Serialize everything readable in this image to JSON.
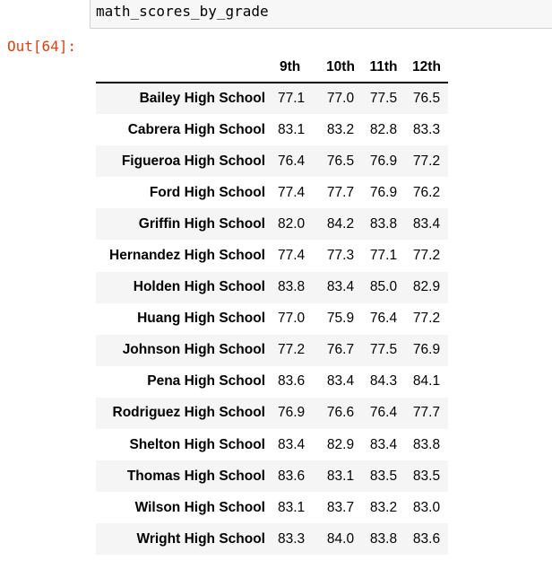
{
  "input_cell": {
    "code": "math_scores_by_grade"
  },
  "output_prompt": "Out[64]:",
  "table": {
    "columns": [
      "9th",
      "10th",
      "11th",
      "12th"
    ],
    "rows": [
      {
        "school": "Bailey High School",
        "values": [
          "77.1",
          "77.0",
          "77.5",
          "76.5"
        ]
      },
      {
        "school": "Cabrera High School",
        "values": [
          "83.1",
          "83.2",
          "82.8",
          "83.3"
        ]
      },
      {
        "school": "Figueroa High School",
        "values": [
          "76.4",
          "76.5",
          "76.9",
          "77.2"
        ]
      },
      {
        "school": "Ford High School",
        "values": [
          "77.4",
          "77.7",
          "76.9",
          "76.2"
        ]
      },
      {
        "school": "Griffin High School",
        "values": [
          "82.0",
          "84.2",
          "83.8",
          "83.4"
        ]
      },
      {
        "school": "Hernandez High School",
        "values": [
          "77.4",
          "77.3",
          "77.1",
          "77.2"
        ]
      },
      {
        "school": "Holden High School",
        "values": [
          "83.8",
          "83.4",
          "85.0",
          "82.9"
        ]
      },
      {
        "school": "Huang High School",
        "values": [
          "77.0",
          "75.9",
          "76.4",
          "77.2"
        ]
      },
      {
        "school": "Johnson High School",
        "values": [
          "77.2",
          "76.7",
          "77.5",
          "76.9"
        ]
      },
      {
        "school": "Pena High School",
        "values": [
          "83.6",
          "83.4",
          "84.3",
          "84.1"
        ]
      },
      {
        "school": "Rodriguez High School",
        "values": [
          "76.9",
          "76.6",
          "76.4",
          "77.7"
        ]
      },
      {
        "school": "Shelton High School",
        "values": [
          "83.4",
          "82.9",
          "83.4",
          "83.8"
        ]
      },
      {
        "school": "Thomas High School",
        "values": [
          "83.6",
          "83.1",
          "83.5",
          "83.5"
        ]
      },
      {
        "school": "Wilson High School",
        "values": [
          "83.1",
          "83.7",
          "83.2",
          "83.0"
        ]
      },
      {
        "school": "Wright High School",
        "values": [
          "83.3",
          "84.0",
          "83.8",
          "83.6"
        ]
      }
    ]
  }
}
